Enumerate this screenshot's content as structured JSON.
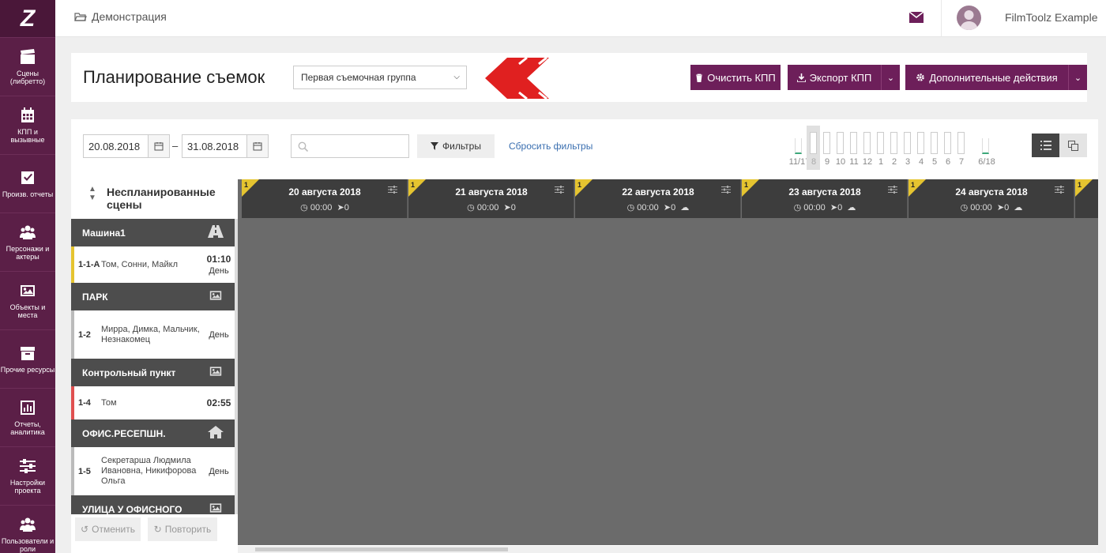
{
  "sidebar": {
    "logo": "Z",
    "items": [
      {
        "label": "Сцены (либретто)",
        "icon": "clapperboard-icon"
      },
      {
        "label": "КПП и вызывные",
        "icon": "calendar-icon"
      },
      {
        "label": "Произв. отчеты",
        "icon": "checkbox-icon"
      },
      {
        "label": "Персонажи и актеры",
        "icon": "users-icon"
      },
      {
        "label": "Объекты и места",
        "icon": "image-icon"
      },
      {
        "label": "Прочие ресурсы",
        "icon": "archive-box-icon"
      },
      {
        "label": "Отчеты, аналитика",
        "icon": "bar-chart-icon"
      },
      {
        "label": "Настройки проекта",
        "icon": "sliders-icon"
      },
      {
        "label": "Пользователи и роли",
        "icon": "users-group-icon"
      }
    ]
  },
  "topbar": {
    "breadcrumb": "Демонстрация",
    "username": "FilmToolz Example"
  },
  "header": {
    "title": "Планирование съемок",
    "group_select": "Первая съемочная группа",
    "clear_btn": "Очистить КПП",
    "export_btn": "Экспорт КПП",
    "more_btn": "Дополнительные действия"
  },
  "toolbar": {
    "date_from": "20.08.2018",
    "date_to": "31.08.2018",
    "dash": "–",
    "search_placeholder": "",
    "filters_btn": "Фильтры",
    "reset_link": "Сбросить фильтры"
  },
  "mini_days": [
    "11/17",
    "8",
    "9",
    "10",
    "11",
    "12",
    "1",
    "2",
    "3",
    "4",
    "5",
    "6",
    "7",
    "6/18"
  ],
  "unscheduled": {
    "title": "Неспланированные сцены",
    "groups": [
      {
        "name": "Машина1",
        "icon": "road-icon",
        "scenes": [
          {
            "num": "1-1-А",
            "chars": "Том, Сонни, Майкл",
            "time": "01:10",
            "daytime": "День",
            "color": "#e5c430"
          }
        ]
      },
      {
        "name": "ПАРК",
        "icon": "image-icon",
        "scenes": [
          {
            "num": "1-2",
            "chars": "Мирра, Димка, Мальчик, Незнакомец",
            "time": "",
            "daytime": "День",
            "color": "#bbbbbb"
          }
        ]
      },
      {
        "name": "Контрольный пункт",
        "icon": "image-icon",
        "scenes": [
          {
            "num": "1-4",
            "chars": "Том",
            "time": "02:55",
            "daytime": "",
            "color": "#e05050"
          }
        ]
      },
      {
        "name": "ОФИС.РЕСЕПШН.",
        "icon": "home-icon",
        "scenes": [
          {
            "num": "1-5",
            "chars": "Секретарша Людмила Ивановна, Никифорова Ольга",
            "time": "",
            "daytime": "День",
            "color": "#bbbbbb"
          }
        ]
      },
      {
        "name": "УЛИЦА У ОФИСНОГО",
        "icon": "image-icon",
        "scenes": []
      }
    ],
    "undo": "Отменить",
    "redo": "Повторить"
  },
  "days": [
    {
      "count": "1",
      "title": "20 августа 2018",
      "time": "00:00",
      "calls": "0",
      "weather": false
    },
    {
      "count": "1",
      "title": "21 августа 2018",
      "time": "00:00",
      "calls": "0",
      "weather": false
    },
    {
      "count": "1",
      "title": "22 августа 2018",
      "time": "00:00",
      "calls": "0",
      "weather": true
    },
    {
      "count": "1",
      "title": "23 августа 2018",
      "time": "00:00",
      "calls": "0",
      "weather": true
    },
    {
      "count": "1",
      "title": "24 августа 2018",
      "time": "00:00",
      "calls": "0",
      "weather": true
    },
    {
      "count": "1",
      "title": "",
      "time": "",
      "calls": "",
      "weather": false
    }
  ],
  "colors": {
    "brand": "#5b1f47",
    "button": "#6d1f5a",
    "accent_red": "#e02020",
    "day_header": "#3d3d3d",
    "calendar_bg": "#6b6b6b"
  }
}
